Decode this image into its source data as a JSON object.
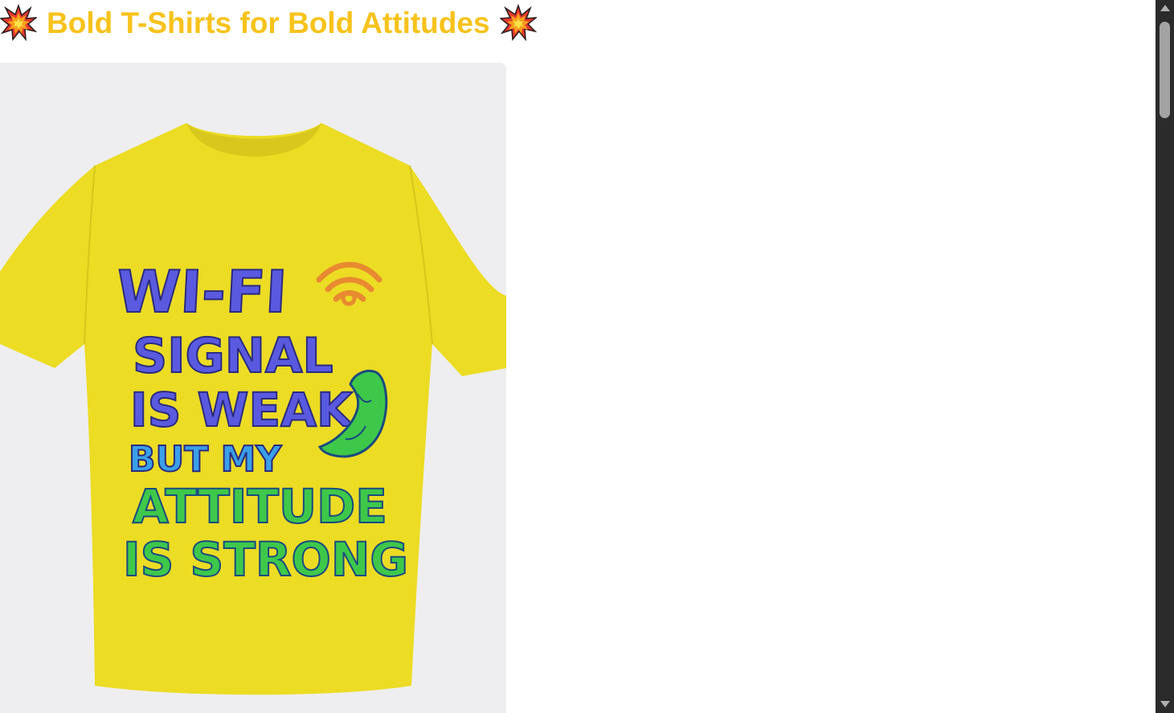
{
  "header": {
    "title": "Bold T-Shirts for Bold Attitudes",
    "left_icon": "collision-icon",
    "right_icon": "collision-icon",
    "title_color": "#f7c21b"
  },
  "product": {
    "shirt_color": "#ecdc24",
    "background": "#eeeef0",
    "print_lines": [
      "WI-FI",
      "SIGNAL",
      "IS WEAK",
      "BUT MY",
      "ATTITUDE",
      "IS STRONG"
    ],
    "print_icons": [
      "wifi-icon",
      "flexed-bicep-icon"
    ]
  },
  "scrollbar": {
    "up_icon": "chevron-up-icon",
    "down_icon": "chevron-down-icon"
  }
}
